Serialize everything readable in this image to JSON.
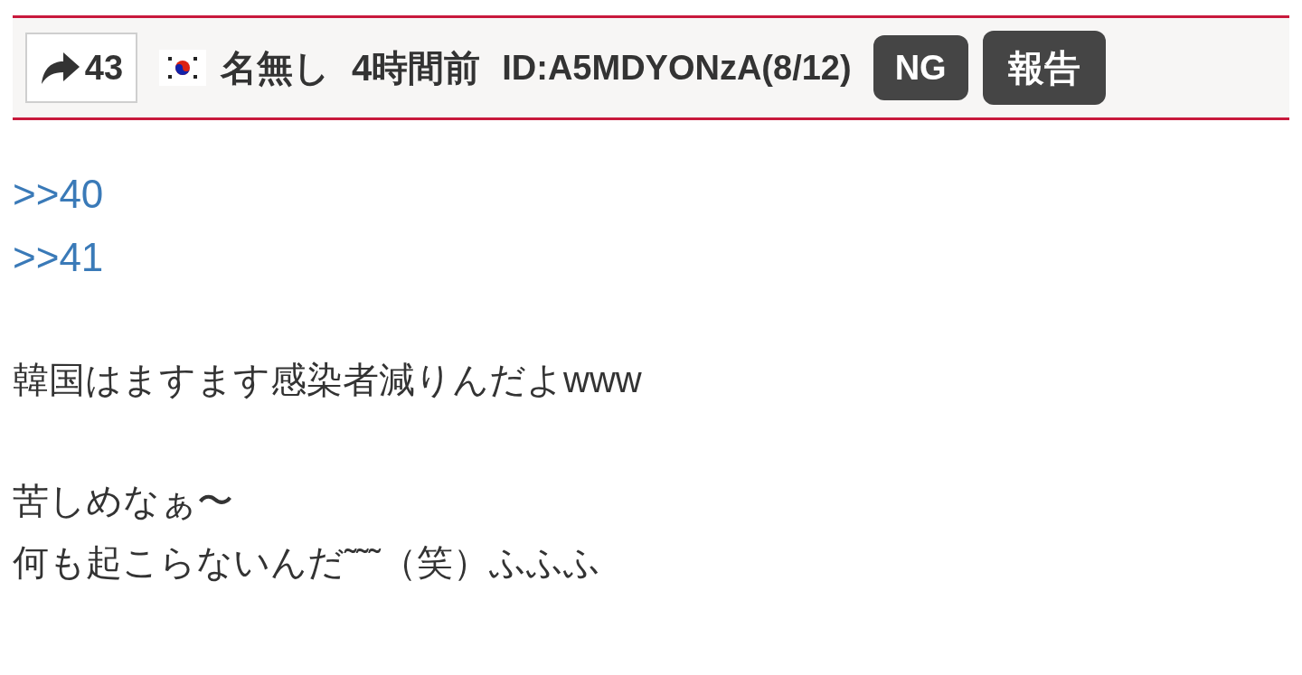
{
  "post": {
    "reply_count": "43",
    "name": "名無し",
    "time": "4時間前",
    "id": "ID:A5MDYONzA(8/12)",
    "buttons": [
      {
        "label": "NG",
        "kind": "ng"
      },
      {
        "label": "報告",
        "kind": "report"
      }
    ]
  },
  "body": [
    {
      "lines": [
        {
          "kind": "anchor",
          "text": ">>40"
        },
        {
          "kind": "anchor",
          "text": ">>41"
        }
      ]
    },
    {
      "lines": [
        {
          "kind": "text",
          "text": "韓国はますます感染者減りんだよwww"
        }
      ]
    },
    {
      "lines": [
        {
          "kind": "text",
          "text": "苦しめなぁ〜"
        },
        {
          "kind": "text",
          "text": "何も起こらないんだ˜˜˜（笑）ふふふ"
        }
      ]
    }
  ]
}
